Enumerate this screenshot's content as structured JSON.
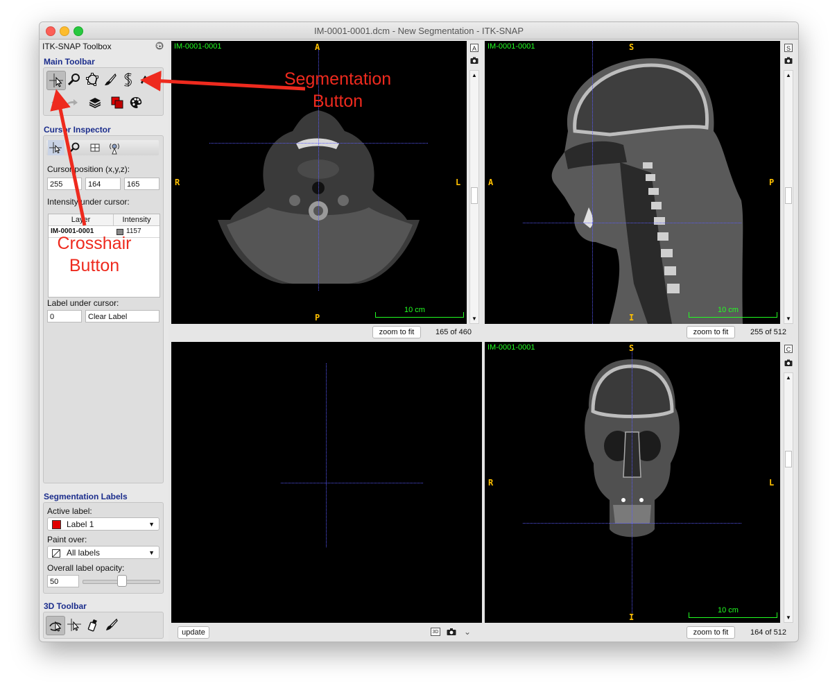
{
  "window": {
    "title": "IM-0001-0001.dcm - New Segmentation - ITK-SNAP"
  },
  "sidebar": {
    "toolbox_title": "ITK-SNAP Toolbox",
    "main_toolbar_title": "Main Toolbar",
    "cursor_inspector_title": "Cursor Inspector",
    "cursor_position_label": "Cursor position (x,y,z):",
    "cursor_x": "255",
    "cursor_y": "164",
    "cursor_z": "165",
    "intensity_label": "Intensity under cursor:",
    "table_header_layer": "Layer",
    "table_header_intensity": "Intensity",
    "table_row_layer": "IM-0001-0001",
    "table_row_intensity": "1157",
    "label_under_cursor_label": "Label under cursor:",
    "label_under_cursor_value": "0",
    "label_under_cursor_name": "Clear Label",
    "segmentation_labels_title": "Segmentation Labels",
    "active_label_label": "Active label:",
    "active_label_value": "Label 1",
    "paint_over_label": "Paint over:",
    "paint_over_value": "All labels",
    "opacity_label": "Overall label opacity:",
    "opacity_value": "50",
    "toolbar_3d_title": "3D Toolbar"
  },
  "views": {
    "axial": {
      "layer": "IM-0001-0001",
      "top": "A",
      "bottom": "P",
      "left": "R",
      "right": "L",
      "scale": "10 cm",
      "zoom_btn": "zoom to fit",
      "slice": "165 of 460"
    },
    "sagittal": {
      "layer": "IM-0001-0001",
      "top": "S",
      "bottom": "I",
      "left": "A",
      "right": "P",
      "scale": "10 cm",
      "zoom_btn": "zoom to fit",
      "slice": "255 of 512"
    },
    "three_d": {
      "update_btn": "update"
    },
    "coronal": {
      "layer": "IM-0001-0001",
      "top": "S",
      "bottom": "I",
      "left": "R",
      "right": "L",
      "scale": "10 cm",
      "zoom_btn": "zoom to fit",
      "slice": "164 of 512"
    },
    "view_badges": {
      "axial": "A",
      "sagittal": "S",
      "coronal": "C",
      "three_d": "3D"
    }
  },
  "annotations": {
    "segmentation_line1": "Segmentation",
    "segmentation_line2": "Button",
    "crosshair_line1": "Crosshair",
    "crosshair_line2": "Button"
  },
  "colors": {
    "annotation_red": "#ee2a1e",
    "overlay_green": "#22ff22",
    "orientation_orange": "#ffc000",
    "crosshair_blue": "#5a5aff",
    "section_title_blue": "#1b2d8c",
    "label1_red": "#e00000"
  }
}
